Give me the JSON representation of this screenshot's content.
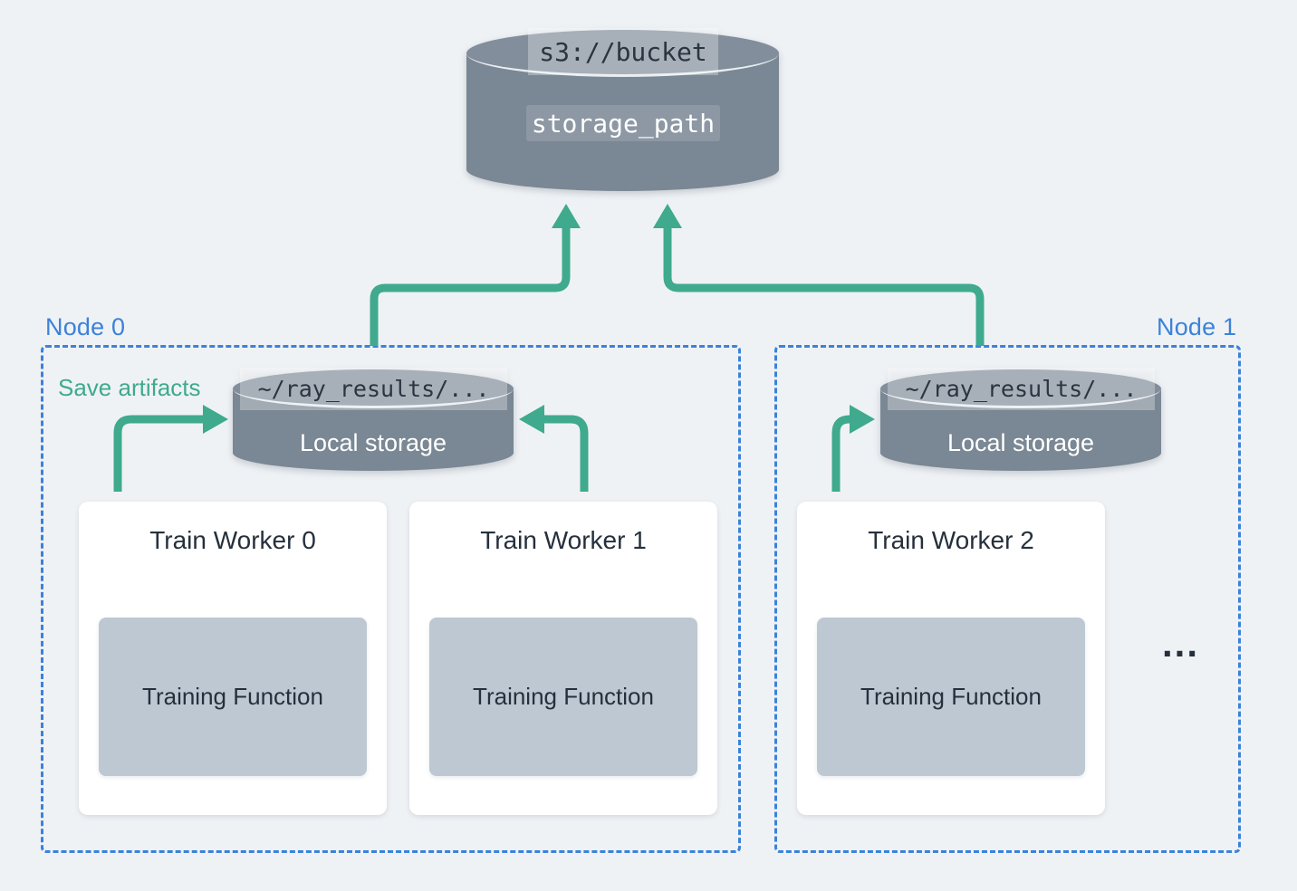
{
  "diagram": {
    "background_color": "#eff2f5",
    "accent_green": "#3faa8d",
    "node_blue": "#3b82d9",
    "cylinder_color": "#7a8794"
  },
  "remote_storage": {
    "chip_label": "s3://bucket",
    "path_label": "storage_path"
  },
  "save_artifacts_label": "Save artifacts",
  "nodes": [
    {
      "label": "Node 0",
      "local_storage": {
        "path_chip": "~/ray_results/...",
        "caption": "Local storage"
      },
      "workers": [
        {
          "title": "Train Worker 0",
          "function_label": "Training Function"
        },
        {
          "title": "Train Worker 1",
          "function_label": "Training Function"
        }
      ],
      "overflow_indicator": ""
    },
    {
      "label": "Node 1",
      "local_storage": {
        "path_chip": "~/ray_results/...",
        "caption": "Local storage"
      },
      "workers": [
        {
          "title": "Train Worker 2",
          "function_label": "Training Function"
        }
      ],
      "overflow_indicator": "..."
    }
  ]
}
